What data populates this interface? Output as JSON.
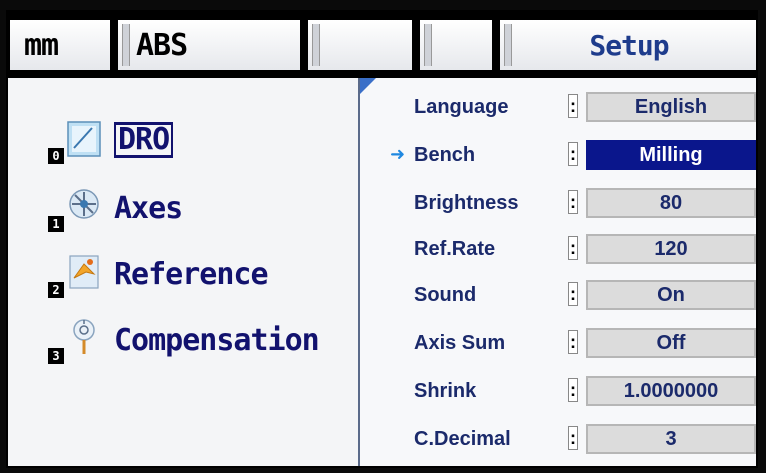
{
  "header": {
    "units": "mm",
    "mode": "ABS",
    "tab3": "",
    "tab4": "",
    "title": "Setup"
  },
  "menu": {
    "items": [
      {
        "num": "0",
        "label": "DRO",
        "icon": "dro-icon"
      },
      {
        "num": "1",
        "label": "Axes",
        "icon": "axes-icon"
      },
      {
        "num": "2",
        "label": "Reference",
        "icon": "reference-icon"
      },
      {
        "num": "3",
        "label": "Compensation",
        "icon": "compensation-icon"
      }
    ]
  },
  "settings": {
    "colon": ":",
    "rows": [
      {
        "name": "Language",
        "value": "English"
      },
      {
        "name": "Bench",
        "value": "Milling",
        "selected": true
      },
      {
        "name": "Brightness",
        "value": "80"
      },
      {
        "name": "Ref.Rate",
        "value": "120"
      },
      {
        "name": "Sound",
        "value": "On"
      },
      {
        "name": "Axis Sum",
        "value": "Off"
      },
      {
        "name": "Shrink",
        "value": "1.0000000"
      },
      {
        "name": "C.Decimal",
        "value": "3"
      }
    ],
    "cursor_glyph": "➜"
  },
  "colors": {
    "selected_bg": "#0a168c",
    "label_text": "#1b2a6b",
    "menu_text": "#12126e",
    "cursor": "#1f88e0"
  }
}
